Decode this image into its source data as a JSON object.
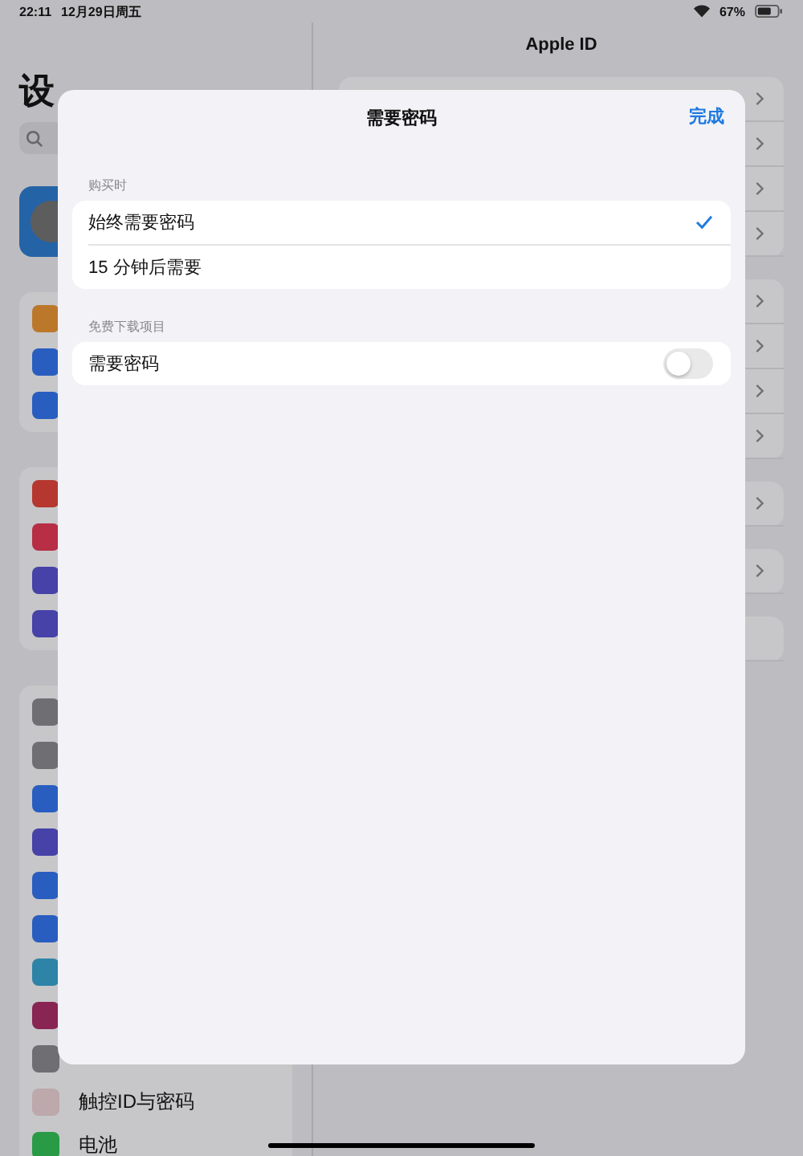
{
  "status_bar": {
    "time": "22:11",
    "date": "12月29日周五",
    "battery": "67%"
  },
  "sidebar": {
    "title": "设",
    "search": {
      "kind": "field"
    },
    "profile": {
      "color": "#2563a7"
    },
    "groups": [
      [
        {
          "color": "#bb782b"
        },
        {
          "color": "#295ec0"
        },
        {
          "color": "#295ec0"
        }
      ],
      [
        {
          "color": "#b5372f"
        },
        {
          "color": "#b72e45"
        },
        {
          "color": "#4642a7"
        },
        {
          "color": "#4642a7"
        }
      ],
      [
        {
          "color": "#6f6f73"
        },
        {
          "color": "#6f6f73"
        },
        {
          "color": "#295ec0"
        },
        {
          "color": "#4642a7"
        },
        {
          "color": "#295ec0"
        },
        {
          "color": "#295ec0"
        },
        {
          "color": "#2d84a7"
        },
        {
          "color": "#892553"
        },
        {
          "color": "#6f6f73"
        },
        {
          "color": "#bda8ac",
          "label": "触控ID与密码"
        },
        {
          "color": "#299b46",
          "label": "电池"
        }
      ]
    ]
  },
  "detail": {
    "title": "Apple ID",
    "groups": [
      [
        {
          "chevron": true
        },
        {
          "chevron": true
        },
        {
          "chevron": true
        },
        {
          "chevron": true
        }
      ],
      [
        {
          "chevron": true
        },
        {
          "chevron": true
        },
        {
          "chevron": true
        },
        {
          "chevron": true
        }
      ],
      [
        {
          "chevron": true
        }
      ],
      [
        {
          "chevron": true
        }
      ],
      [
        {
          "chevron": false
        }
      ]
    ]
  },
  "sheet": {
    "title": "需要密码",
    "done": "完成",
    "sections": [
      {
        "header": "购买时",
        "rows": [
          {
            "kind": "choice",
            "label": "始终需要密码",
            "selected": true
          },
          {
            "kind": "choice",
            "label": "15 分钟后需要",
            "selected": false
          }
        ]
      },
      {
        "header": "免费下载项目",
        "rows": [
          {
            "kind": "toggle",
            "label": "需要密码",
            "on": false
          }
        ]
      }
    ]
  }
}
